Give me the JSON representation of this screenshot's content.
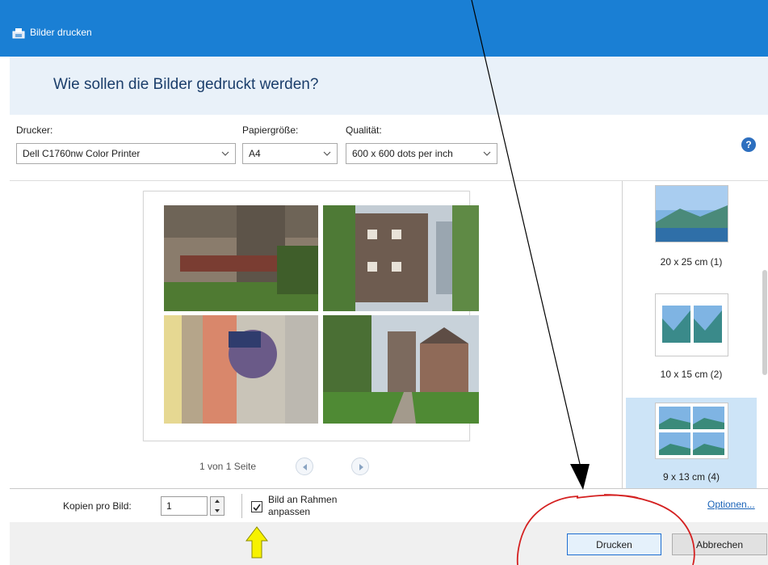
{
  "window": {
    "title": "Bilder drucken",
    "icon": "print-pictures-icon"
  },
  "header": {
    "heading": "Wie sollen die Bilder gedruckt werden?"
  },
  "settings": {
    "printer": {
      "label": "Drucker:",
      "value": "Dell C1760nw Color Printer"
    },
    "paper": {
      "label": "Papiergröße:",
      "value": "A4"
    },
    "quality": {
      "label": "Qualität:",
      "value": "600 x 600 dots per inch"
    },
    "help_icon": "?"
  },
  "preview": {
    "photos": [
      {
        "name": "photo-stone-gate-pillar",
        "palette": [
          "#7a6a5a",
          "#8e8272",
          "#4f6b3a"
        ]
      },
      {
        "name": "photo-castle-tower-rotated",
        "palette": [
          "#6f5e55",
          "#4d7a3a",
          "#bfcad3"
        ]
      },
      {
        "name": "photo-house-sign-rotated",
        "palette": [
          "#d98a6e",
          "#c8c3b6",
          "#e9d9a0"
        ]
      },
      {
        "name": "photo-park-towers",
        "palette": [
          "#4f7a35",
          "#8a7468",
          "#c9d3dc"
        ]
      }
    ],
    "pager_text": "1 von 1 Seite"
  },
  "layouts": [
    {
      "caption": "20 x 25 cm (1)",
      "selected": false
    },
    {
      "caption": "10 x 15 cm (2)",
      "selected": false
    },
    {
      "caption": "9 x 13 cm (4)",
      "selected": true
    }
  ],
  "bottom": {
    "copies_label": "Kopien pro Bild:",
    "copies_value": "1",
    "fit_label_line1": "Bild an Rahmen",
    "fit_label_line2": "anpassen",
    "fit_checked": true,
    "options_link": "Optionen..."
  },
  "footer": {
    "print_button": "Drucken",
    "cancel_button": "Abbrechen"
  },
  "annotations": {
    "arrow_color": "#000000",
    "circle_color": "#d42020",
    "pointer_color": "#f7f200"
  }
}
